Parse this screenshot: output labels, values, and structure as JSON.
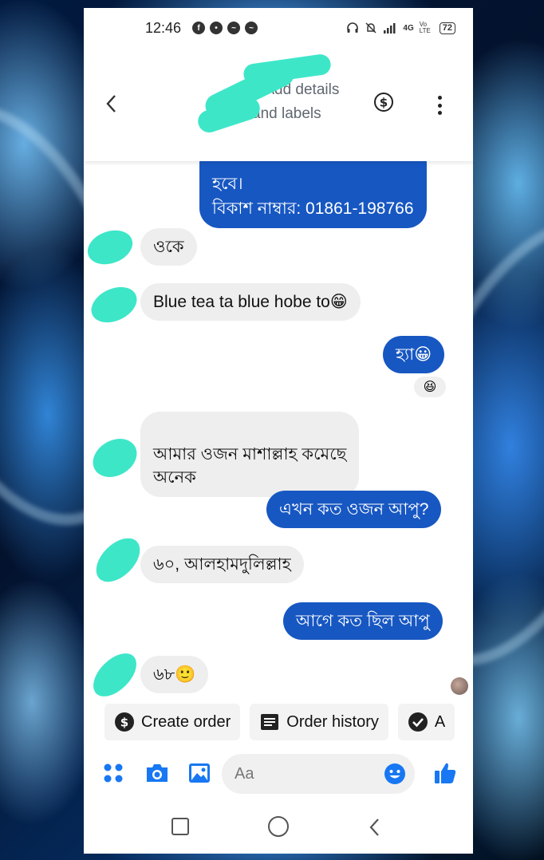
{
  "status_bar": {
    "time": "12:46",
    "app_icons": [
      "facebook-icon",
      "messenger-icon",
      "messenger-icon",
      "messenger-icon"
    ],
    "network": "4G",
    "volte": "Vo LTE",
    "battery": "72"
  },
  "header": {
    "contact_name": ". . . ..",
    "add_details": "+ Add details and labels"
  },
  "messages": [
    {
      "side": "out",
      "text": "হবে।\nবিকাশ নাম্বার: 01861-198766"
    },
    {
      "side": "in",
      "text": "ওকে"
    },
    {
      "side": "in",
      "text": "Blue tea ta blue hobe to😁"
    },
    {
      "side": "out",
      "text": "হ্যা😀",
      "reaction": "😆"
    },
    {
      "side": "in",
      "text": "আমার ওজন মাশাল্লাহ কমেছে\nঅনেক"
    },
    {
      "side": "out",
      "text": "এখন কত ওজন আপু?"
    },
    {
      "side": "in",
      "text": "৬০, আলহামদুলিল্লাহ"
    },
    {
      "side": "out",
      "text": "আগে কত ছিল আপু"
    },
    {
      "side": "in",
      "text": "৬৮🙂"
    }
  ],
  "actions": {
    "create_order": "Create order",
    "order_history": "Order history",
    "third": "A"
  },
  "composer": {
    "placeholder": "Aa"
  },
  "colors": {
    "brand_blue": "#1757c2",
    "icon_blue": "#1877f2",
    "redaction": "#3ee6c8"
  }
}
